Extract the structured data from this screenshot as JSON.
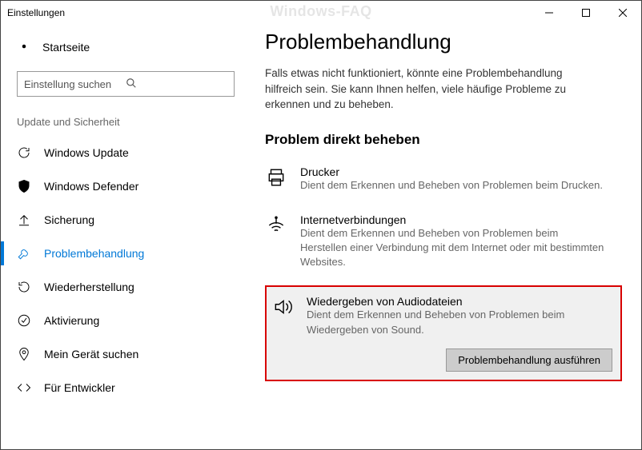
{
  "window": {
    "title": "Einstellungen"
  },
  "watermark": "Windows-FAQ",
  "sidebar": {
    "home": "Startseite",
    "search_placeholder": "Einstellung suchen",
    "section": "Update und Sicherheit",
    "items": [
      {
        "label": "Windows Update"
      },
      {
        "label": "Windows Defender"
      },
      {
        "label": "Sicherung"
      },
      {
        "label": "Problembehandlung"
      },
      {
        "label": "Wiederherstellung"
      },
      {
        "label": "Aktivierung"
      },
      {
        "label": "Mein Gerät suchen"
      },
      {
        "label": "Für Entwickler"
      }
    ]
  },
  "main": {
    "heading": "Problembehandlung",
    "intro": "Falls etwas nicht funktioniert, könnte eine Problembehandlung hilfreich sein. Sie kann Ihnen helfen, viele häufige Probleme zu erkennen und zu beheben.",
    "subheading": "Problem direkt beheben",
    "troubleshooters": [
      {
        "title": "Drucker",
        "desc": "Dient dem Erkennen und Beheben von Problemen beim Drucken."
      },
      {
        "title": "Internetverbindungen",
        "desc": "Dient dem Erkennen und Beheben von Problemen beim Herstellen einer Verbindung mit dem Internet oder mit bestimmten Websites."
      },
      {
        "title": "Wiedergeben von Audiodateien",
        "desc": "Dient dem Erkennen und Beheben von Problemen beim Wiedergeben von Sound."
      }
    ],
    "run_button": "Problembehandlung ausführen"
  }
}
